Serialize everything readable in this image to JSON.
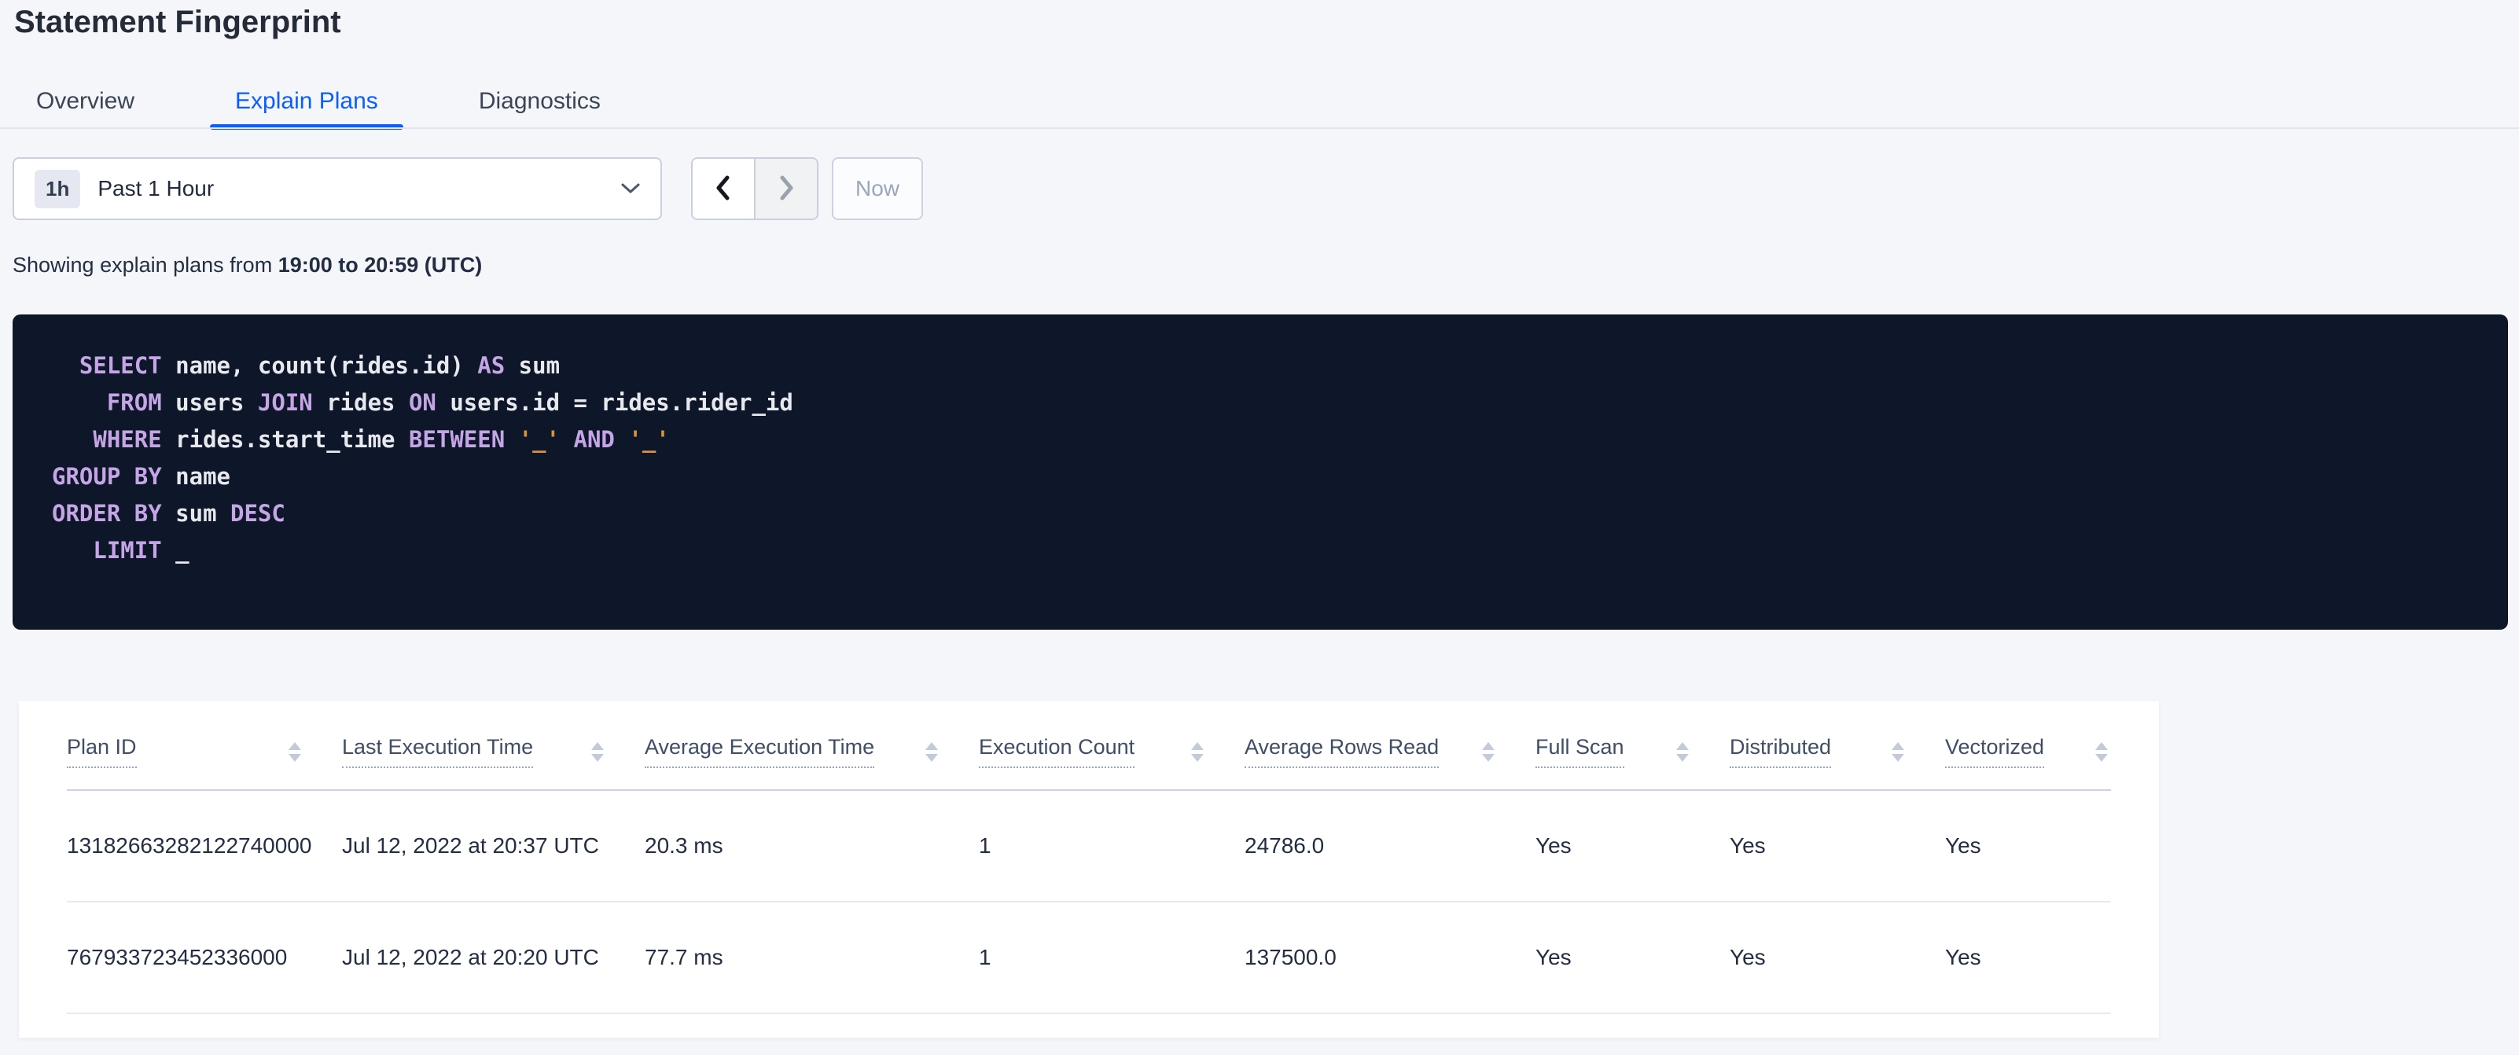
{
  "page": {
    "title": "Statement Fingerprint"
  },
  "tabs": [
    {
      "label": "Overview",
      "active": false
    },
    {
      "label": "Explain Plans",
      "active": true
    },
    {
      "label": "Diagnostics",
      "active": false
    }
  ],
  "time_picker": {
    "badge": "1h",
    "label": "Past 1 Hour",
    "now_label": "Now",
    "prev_enabled": true,
    "next_enabled": false,
    "icons": [
      "chevron-down-icon",
      "chevron-left-icon",
      "chevron-right-icon"
    ]
  },
  "subtitle": {
    "prefix": "Showing explain plans from ",
    "bold": "19:00 to 20:59 (UTC)"
  },
  "sql": {
    "lines": [
      [
        {
          "c": "kw",
          "t": "  SELECT"
        },
        {
          "c": "pl",
          "t": " name, count(rides.id) "
        },
        {
          "c": "kw",
          "t": "AS"
        },
        {
          "c": "pl",
          "t": " sum"
        }
      ],
      [
        {
          "c": "kw",
          "t": "    FROM"
        },
        {
          "c": "pl",
          "t": " users "
        },
        {
          "c": "kw",
          "t": "JOIN"
        },
        {
          "c": "pl",
          "t": " rides "
        },
        {
          "c": "kw",
          "t": "ON"
        },
        {
          "c": "pl",
          "t": " users.id = rides.rider_id"
        }
      ],
      [
        {
          "c": "kw",
          "t": "   WHERE"
        },
        {
          "c": "pl",
          "t": " rides.start_time "
        },
        {
          "c": "kw",
          "t": "BETWEEN"
        },
        {
          "c": "pl",
          "t": " "
        },
        {
          "c": "str",
          "t": "'_'"
        },
        {
          "c": "pl",
          "t": " "
        },
        {
          "c": "kw",
          "t": "AND"
        },
        {
          "c": "pl",
          "t": " "
        },
        {
          "c": "str",
          "t": "'_'"
        }
      ],
      [
        {
          "c": "kw",
          "t": "GROUP BY"
        },
        {
          "c": "pl",
          "t": " name"
        }
      ],
      [
        {
          "c": "kw",
          "t": "ORDER BY"
        },
        {
          "c": "pl",
          "t": " sum "
        },
        {
          "c": "kw",
          "t": "DESC"
        }
      ],
      [
        {
          "c": "kw",
          "t": "   LIMIT"
        },
        {
          "c": "pl",
          "t": " _"
        }
      ]
    ]
  },
  "table": {
    "columns": [
      "Plan ID",
      "Last Execution Time",
      "Average Execution Time",
      "Execution Count",
      "Average Rows Read",
      "Full Scan",
      "Distributed",
      "Vectorized"
    ],
    "rows": [
      [
        "13182663282122740000",
        "Jul 12, 2022 at 20:37 UTC",
        "20.3 ms",
        "1",
        "24786.0",
        "Yes",
        "Yes",
        "Yes"
      ],
      [
        "767933723452336000",
        "Jul 12, 2022 at 20:20 UTC",
        "77.7 ms",
        "1",
        "137500.0",
        "Yes",
        "Yes",
        "Yes"
      ]
    ]
  },
  "colors": {
    "accent_blue": "#0b5dfc",
    "page_background": "#f4f6fa",
    "sql_background": "#0e1729",
    "sql_keyword": "#c5a5e6",
    "sql_string": "#d9923d",
    "sql_plain": "#e7e9ee",
    "card_background": "#ffffff"
  }
}
